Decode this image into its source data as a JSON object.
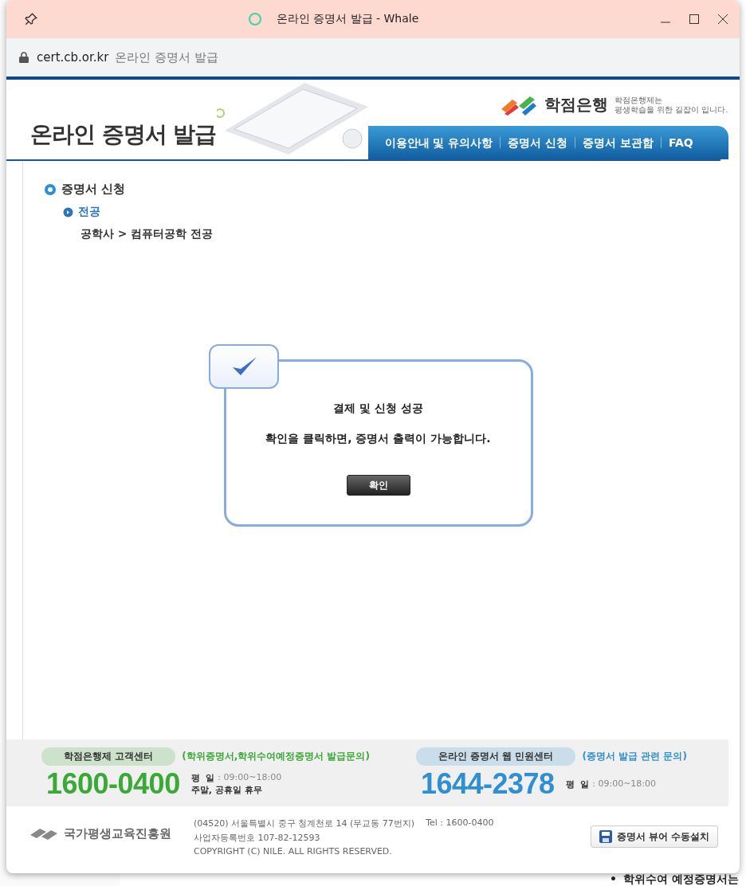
{
  "window": {
    "title": "온라인 증명서 발급 - Whale"
  },
  "address_bar": {
    "domain": "cert.cb.or.kr",
    "page_title": "온라인 증명서 발급"
  },
  "header": {
    "site_title": "온라인 증명서 발급",
    "brand": {
      "name": "학점은행",
      "tagline": [
        "학점은행제는",
        "평생학습을 위한 길잡이 입니다."
      ]
    },
    "nav": [
      "이용안내 및 유의사항",
      "증명서 신청",
      "증명서 보관함",
      "FAQ"
    ]
  },
  "section": {
    "title": "증명서 신청",
    "subtitle": "전공",
    "path": "공학사 > 컴퓨터공학 전공"
  },
  "dialog": {
    "title": "결제 및 신청 성공",
    "message": "확인을 클릭하면, 증명서 출력이 가능합니다.",
    "button": "확인"
  },
  "contacts": [
    {
      "label": "학점은행제 고객센터",
      "note": "(학위증명서,학위수여예정증명서 발급문의)",
      "phone": "1600-0400",
      "hours_label": "평  일",
      "hours": ": 09:00~18:00",
      "extra": "주말, 공휴일 휴무",
      "color": "#3aa935"
    },
    {
      "label": "온라인 증명서 웹 민원센터",
      "note": "(증명서 발급 관련 문의)",
      "phone": "1644-2378",
      "hours_label": "평  일",
      "hours": ": 09:00~18:00",
      "color": "#2f8fd0"
    }
  ],
  "footer": {
    "org": "국가평생교육진흥원",
    "address": "(04520) 서울특별시 중구 청계천로 14 (무교동 77번지)",
    "tel": "Tel : 1600-0400",
    "registration": "사업자등록번호 107-82-12593",
    "copyright": "COPYRIGHT (C) NILE. ALL RIGHTS RESERVED.",
    "button": "증명서 뷰어 수동설치"
  },
  "background_page": {
    "bullet": "•",
    "text": "학위수여 예정증명서는"
  }
}
